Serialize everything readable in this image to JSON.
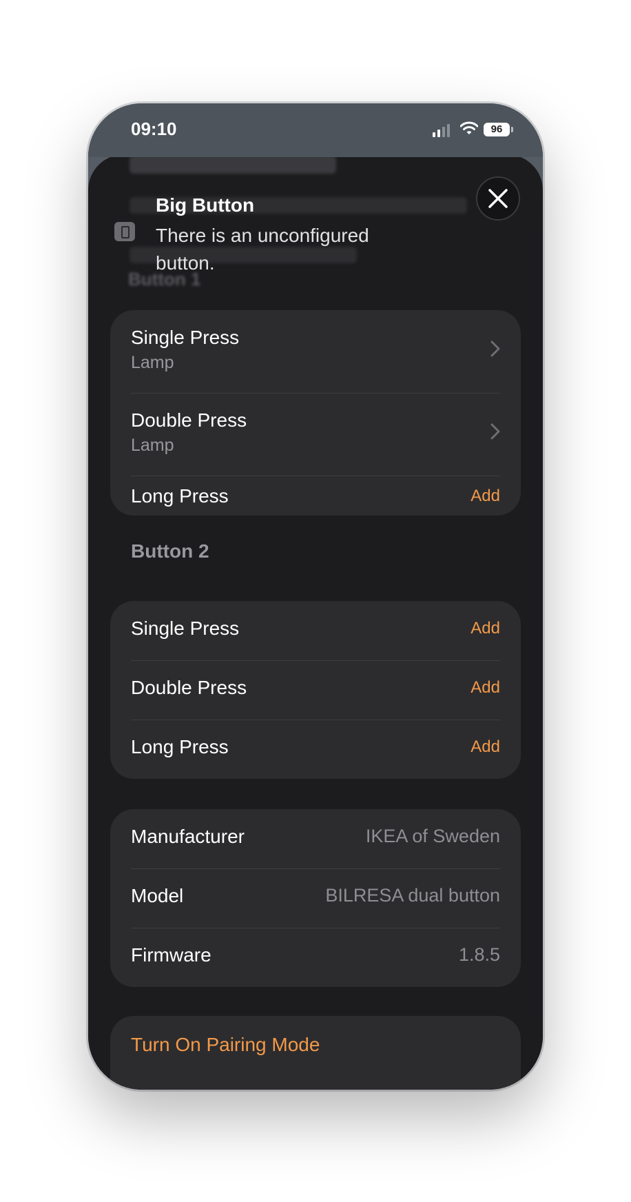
{
  "status_bar": {
    "time": "09:10",
    "battery": "96"
  },
  "header": {
    "title": "Big Button",
    "subtitle": "There is an unconfigured button."
  },
  "sections": [
    {
      "title": "Button 1",
      "rows": [
        {
          "label": "Single Press",
          "detail": "Lamp"
        },
        {
          "label": "Double Press",
          "detail": "Lamp"
        },
        {
          "label": "Long Press",
          "action": "Add"
        }
      ]
    },
    {
      "title": "Button 2",
      "rows": [
        {
          "label": "Single Press",
          "action": "Add"
        },
        {
          "label": "Double Press",
          "action": "Add"
        },
        {
          "label": "Long Press",
          "action": "Add"
        }
      ]
    }
  ],
  "info": [
    {
      "label": "Manufacturer",
      "value": "IKEA of Sweden"
    },
    {
      "label": "Model",
      "value": "BILRESA dual button"
    },
    {
      "label": "Firmware",
      "value": "1.8.5"
    }
  ],
  "pairing_button": "Turn On Pairing Mode",
  "colors": {
    "accent": "#f2994a",
    "background": "#1c1c1e",
    "card": "#2c2c2e"
  }
}
